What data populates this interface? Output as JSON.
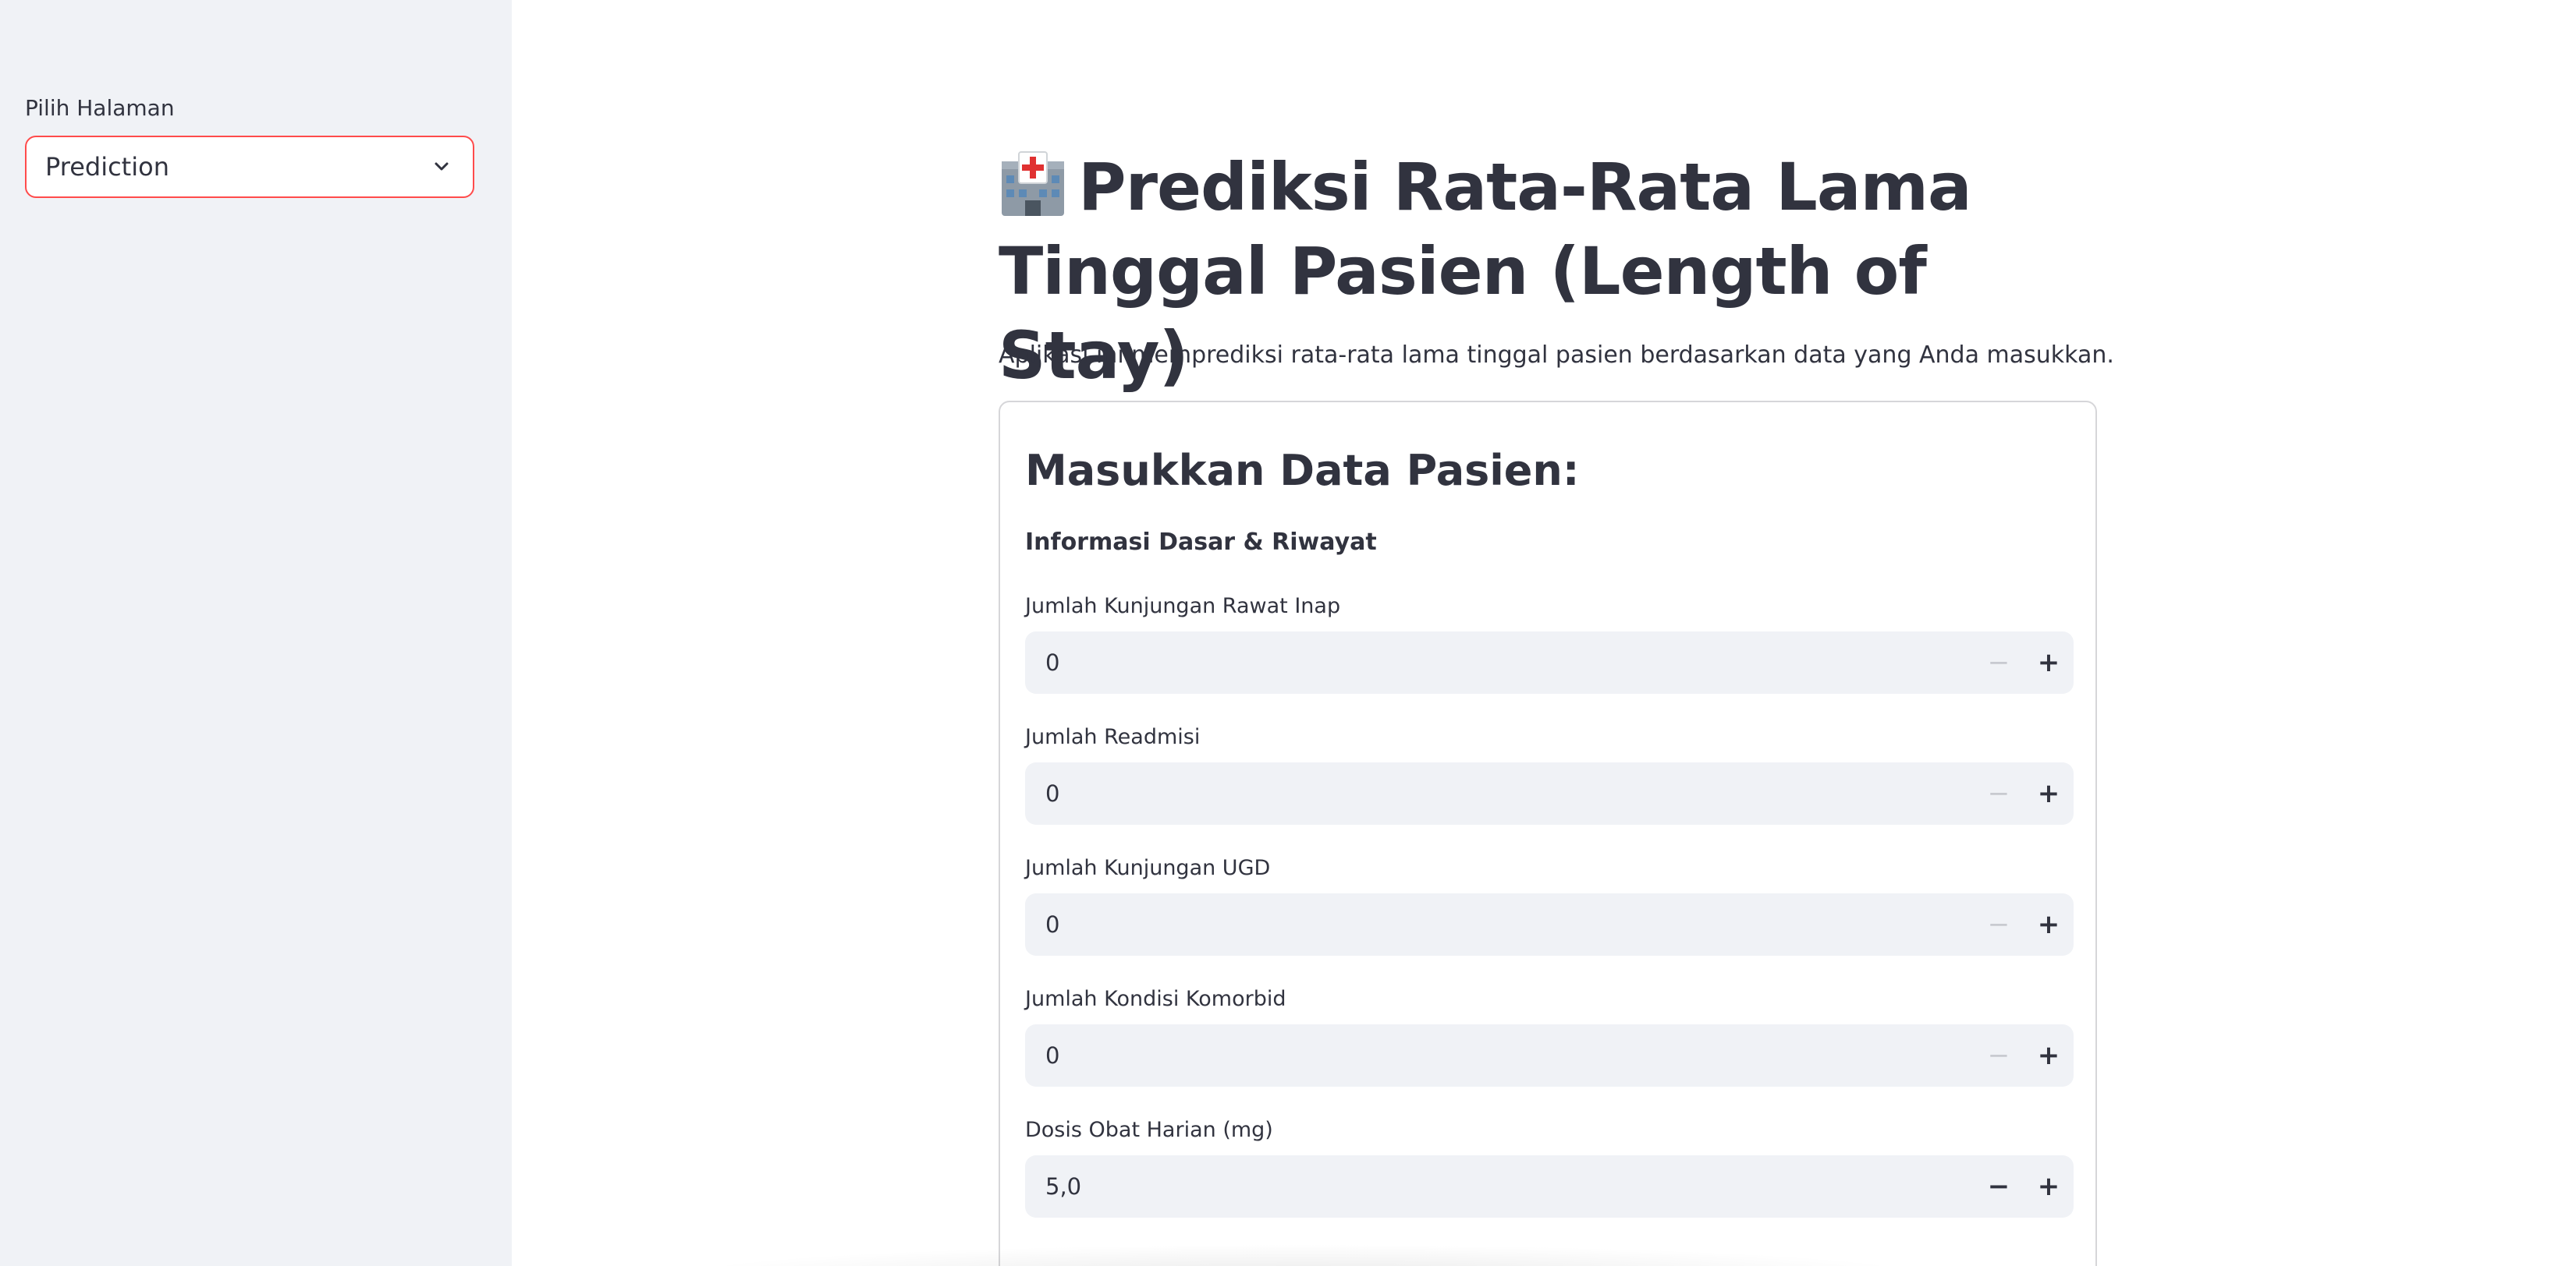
{
  "sidebar": {
    "page_select_label": "Pilih Halaman",
    "page_select_value": "Prediction"
  },
  "main": {
    "title": "Prediksi Rata-Rata Lama Tinggal Pasien (Length of Stay)",
    "title_icon": "hospital-icon",
    "description": "Aplikasi ini memprediksi rata-rata lama tinggal pasien berdasarkan data yang Anda masukkan.",
    "form": {
      "heading": "Masukkan Data Pasien:",
      "subheading": "Informasi Dasar & Riwayat",
      "fields": [
        {
          "label": "Jumlah Kunjungan Rawat Inap",
          "value": "0",
          "minus": "−",
          "plus": "+"
        },
        {
          "label": "Jumlah Readmisi",
          "value": "0",
          "minus": "−",
          "plus": "+"
        },
        {
          "label": "Jumlah Kunjungan UGD",
          "value": "0",
          "minus": "−",
          "plus": "+"
        },
        {
          "label": "Jumlah Kondisi Komorbid",
          "value": "0",
          "minus": "−",
          "plus": "+"
        },
        {
          "label": "Dosis Obat Harian (mg)",
          "value": "5,0",
          "minus": "−",
          "plus": "+"
        }
      ]
    }
  },
  "colors": {
    "sidebar_bg": "#f0f2f6",
    "accent": "#ff4b4b",
    "text": "#31333f",
    "input_bg": "#f0f2f6"
  }
}
